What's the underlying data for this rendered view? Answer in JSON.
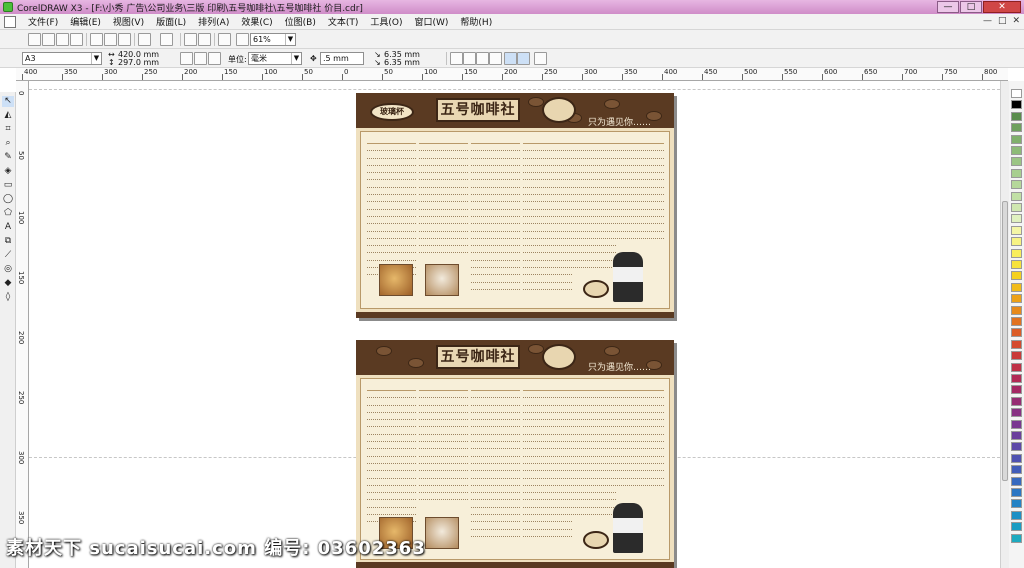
{
  "window": {
    "title": "CorelDRAW X3 - [F:\\小秀 广告\\公司业务\\三版 印刷\\五号咖啡社\\五号咖啡社 价目.cdr]",
    "minimize": "—",
    "maximize": "□",
    "close": "✕"
  },
  "menu": {
    "items": [
      "文件(F)",
      "编辑(E)",
      "视图(V)",
      "版面(L)",
      "排列(A)",
      "效果(C)",
      "位图(B)",
      "文本(T)",
      "工具(O)",
      "窗口(W)",
      "帮助(H)"
    ],
    "mdi_controls": [
      "—",
      "□",
      "✕"
    ]
  },
  "toolbar1": {
    "zoom_value": "61%"
  },
  "toolbar2": {
    "paper_size": "A3",
    "width": "420.0 mm",
    "height": "297.0 mm",
    "units_label": "单位:",
    "units_value": "毫米",
    "nudge": ".5 mm",
    "dup_x": "6.35 mm",
    "dup_y": "6.35 mm"
  },
  "ruler": {
    "h_labels": [
      "400",
      "350",
      "300",
      "250",
      "200",
      "150",
      "100",
      "50",
      "0",
      "50",
      "100",
      "150",
      "200",
      "250",
      "300",
      "350",
      "400",
      "450",
      "500",
      "550",
      "600",
      "650",
      "700",
      "750",
      "800"
    ],
    "v_labels": [
      "0",
      "50",
      "100",
      "150",
      "200",
      "250",
      "300",
      "350"
    ]
  },
  "toolbox": {
    "tools": [
      "pick-tool",
      "shape-tool",
      "crop-tool",
      "zoom-tool",
      "freehand-tool",
      "smart-fill-tool",
      "rectangle-tool",
      "ellipse-tool",
      "polygon-tool",
      "text-tool",
      "interactive-blend-tool",
      "eyedropper-tool",
      "outline-tool",
      "fill-tool",
      "interactive-fill-tool"
    ]
  },
  "palette": {
    "colors": [
      "#ffffff",
      "#000000",
      "#5a8d4d",
      "#6fa15e",
      "#80b06c",
      "#8dbb77",
      "#9bc584",
      "#a7cf8f",
      "#b5d89a",
      "#c1e0a5",
      "#d0e8b0",
      "#e0f1c0",
      "#f4f6a6",
      "#f7f383",
      "#f8ee5c",
      "#f7e33b",
      "#f4d11f",
      "#f1bb1a",
      "#eda117",
      "#e78a1b",
      "#e1721f",
      "#db5c26",
      "#d44a2e",
      "#c93a39",
      "#bf3046",
      "#b22a55",
      "#a42864",
      "#962c73",
      "#883183",
      "#7a3791",
      "#6b3f9d",
      "#5d48a8",
      "#4f52b1",
      "#425db9",
      "#3669bf",
      "#2c76c3",
      "#2483c5",
      "#1e90c5",
      "#1b9dc3",
      "#1eaabf"
    ]
  },
  "boards": [
    {
      "logo": "五号咖啡社",
      "badge": "玻璃杯",
      "slogan": "只为遇见你……"
    },
    {
      "logo": "五号咖啡社",
      "badge": "",
      "slogan": "只为遇见你……"
    }
  ],
  "watermark": "素材天下 sucaisucai.com   编号: 03602363"
}
